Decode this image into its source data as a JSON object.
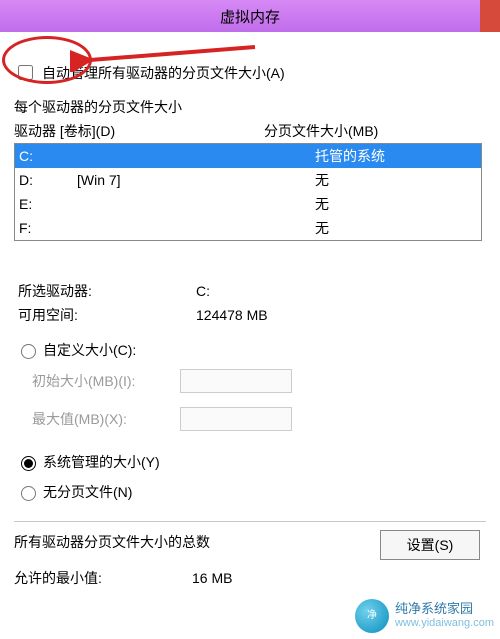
{
  "window": {
    "title": "虚拟内存"
  },
  "auto_manage": {
    "checked": false,
    "label": "自动管理所有驱动器的分页文件大小(A)"
  },
  "per_drive_header": "每个驱动器的分页文件大小",
  "columns": {
    "drive": "驱动器 [卷标](D)",
    "size": "分页文件大小(MB)"
  },
  "drives": [
    {
      "letter": "C:",
      "label": "",
      "size": "托管的系统",
      "selected": true
    },
    {
      "letter": "D:",
      "label": "[Win 7]",
      "size": "无",
      "selected": false
    },
    {
      "letter": "E:",
      "label": "",
      "size": "无",
      "selected": false
    },
    {
      "letter": "F:",
      "label": "",
      "size": "无",
      "selected": false
    }
  ],
  "selected_info": {
    "drive_key": "所选驱动器:",
    "drive_val": "C:",
    "free_key": "可用空间:",
    "free_val": "124478 MB"
  },
  "radios": {
    "custom": "自定义大小(C):",
    "system": "系统管理的大小(Y)",
    "none": "无分页文件(N)",
    "selected": "system"
  },
  "custom_fields": {
    "initial_label": "初始大小(MB)(I):",
    "initial_value": "",
    "max_label": "最大值(MB)(X):",
    "max_value": ""
  },
  "set_button": "设置(S)",
  "total_header": "所有驱动器分页文件大小的总数",
  "totals": {
    "min_key": "允许的最小值:",
    "min_val": "16 MB"
  },
  "watermark": {
    "name": "纯净系统家园",
    "url": "www.yidaiwang.com"
  }
}
